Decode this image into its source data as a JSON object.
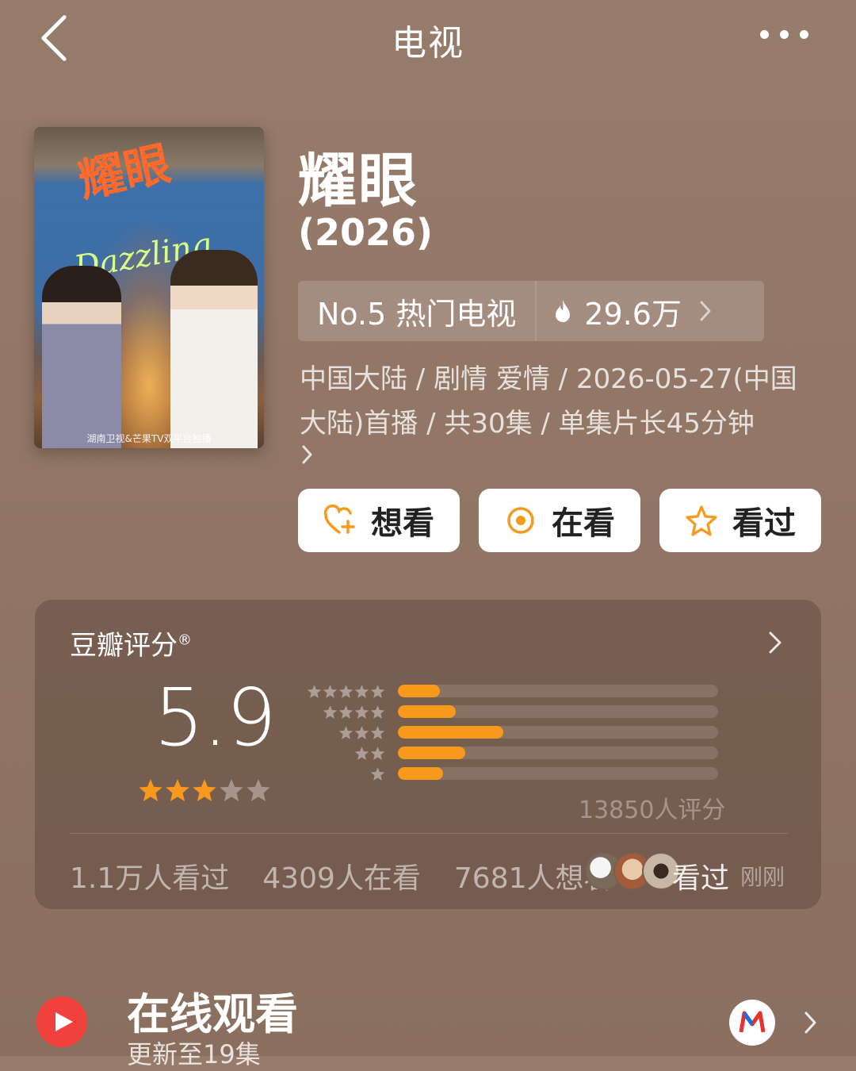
{
  "header": {
    "title": "电视"
  },
  "poster": {
    "title": "耀眼",
    "script": "Dazzling",
    "footer": "湖南卫视&芒果TV双平台独播"
  },
  "show": {
    "title": "耀眼",
    "year": "(2026)"
  },
  "rank": {
    "label": "No.5 热门电视",
    "heat": "29.6万"
  },
  "meta": {
    "text": "中国大陆 / 剧情 爱情 / 2026-05-27(中国大陆)首播 / 共30集 / 单集片长45分钟"
  },
  "actions": [
    {
      "label": "想看",
      "icon": "heart-plus-icon"
    },
    {
      "label": "在看",
      "icon": "target-icon"
    },
    {
      "label": "看过",
      "icon": "star-outline-icon"
    }
  ],
  "rating": {
    "title": "豆瓣评分",
    "registered": "®",
    "score": "5.9",
    "stars": 3,
    "distribution": [
      {
        "stars": 5,
        "fraction": 0.13
      },
      {
        "stars": 4,
        "fraction": 0.18
      },
      {
        "stars": 3,
        "fraction": 0.33
      },
      {
        "stars": 2,
        "fraction": 0.21
      },
      {
        "stars": 1,
        "fraction": 0.14
      }
    ],
    "count": "13850人评分",
    "watched": "1.1万人看过",
    "watching": "4309人在看",
    "want": "7681人想看",
    "activity": "看过",
    "activity_time": "刚刚"
  },
  "online": {
    "title": "在线观看",
    "subtitle": "更新至19集"
  },
  "colors": {
    "accent": "#f7991c",
    "play": "#f0413c"
  }
}
